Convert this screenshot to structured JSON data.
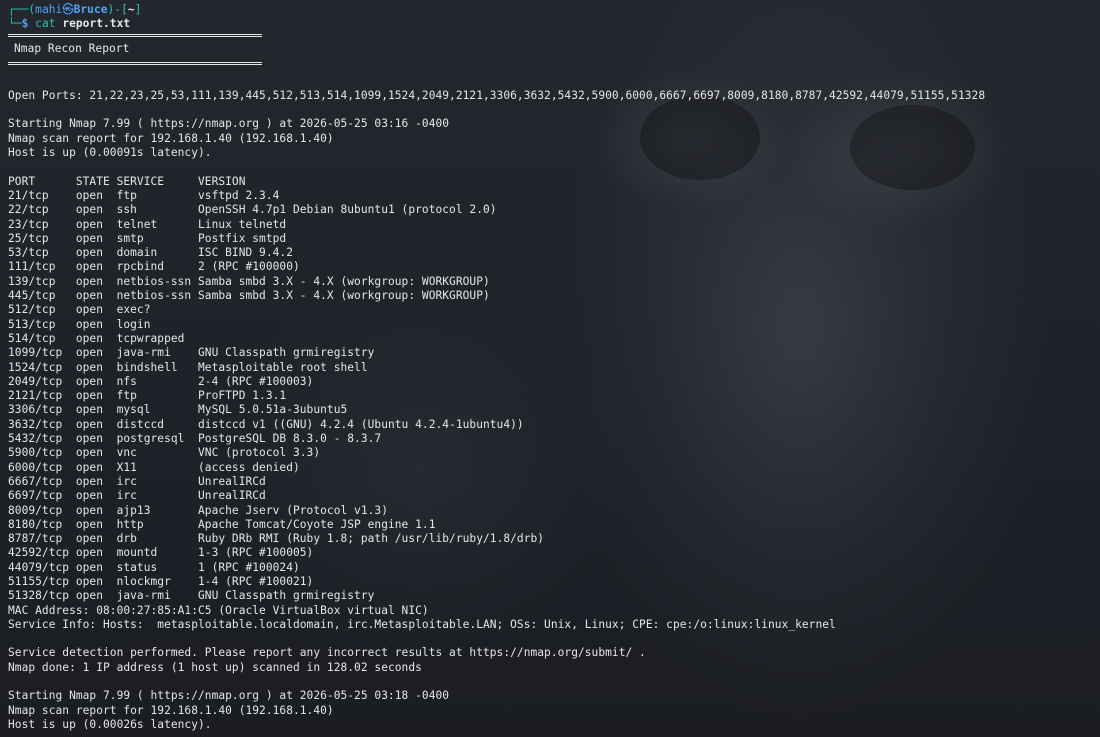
{
  "prompt": {
    "user": "mahi",
    "separator": "㉿",
    "host": "Bruce",
    "path": "~",
    "command": "cat",
    "argument": "report.txt"
  },
  "banner_title": "Nmap Recon Report",
  "open_ports_line": "Open Ports: 21,22,23,25,53,111,139,445,512,513,514,1099,1524,2049,2121,3306,3632,5432,5900,6000,6667,6697,8009,8180,8787,42592,44079,51155,51328",
  "scan1": {
    "starting": "Starting Nmap 7.99 ( https://nmap.org ) at 2026-05-25 03:16 -0400",
    "report_for": "Nmap scan report for 192.168.1.40 (192.168.1.40)",
    "host_up": "Host is up (0.00091s latency)."
  },
  "table": {
    "header": "PORT      STATE SERVICE     VERSION",
    "rows": [
      "21/tcp    open  ftp         vsftpd 2.3.4",
      "22/tcp    open  ssh         OpenSSH 4.7p1 Debian 8ubuntu1 (protocol 2.0)",
      "23/tcp    open  telnet      Linux telnetd",
      "25/tcp    open  smtp        Postfix smtpd",
      "53/tcp    open  domain      ISC BIND 9.4.2",
      "111/tcp   open  rpcbind     2 (RPC #100000)",
      "139/tcp   open  netbios-ssn Samba smbd 3.X - 4.X (workgroup: WORKGROUP)",
      "445/tcp   open  netbios-ssn Samba smbd 3.X - 4.X (workgroup: WORKGROUP)",
      "512/tcp   open  exec?",
      "513/tcp   open  login",
      "514/tcp   open  tcpwrapped",
      "1099/tcp  open  java-rmi    GNU Classpath grmiregistry",
      "1524/tcp  open  bindshell   Metasploitable root shell",
      "2049/tcp  open  nfs         2-4 (RPC #100003)",
      "2121/tcp  open  ftp         ProFTPD 1.3.1",
      "3306/tcp  open  mysql       MySQL 5.0.51a-3ubuntu5",
      "3632/tcp  open  distccd     distccd v1 ((GNU) 4.2.4 (Ubuntu 4.2.4-1ubuntu4))",
      "5432/tcp  open  postgresql  PostgreSQL DB 8.3.0 - 8.3.7",
      "5900/tcp  open  vnc         VNC (protocol 3.3)",
      "6000/tcp  open  X11         (access denied)",
      "6667/tcp  open  irc         UnrealIRCd",
      "6697/tcp  open  irc         UnrealIRCd",
      "8009/tcp  open  ajp13       Apache Jserv (Protocol v1.3)",
      "8180/tcp  open  http        Apache Tomcat/Coyote JSP engine 1.1",
      "8787/tcp  open  drb         Ruby DRb RMI (Ruby 1.8; path /usr/lib/ruby/1.8/drb)",
      "42592/tcp open  mountd      1-3 (RPC #100005)",
      "44079/tcp open  status      1 (RPC #100024)",
      "51155/tcp open  nlockmgr    1-4 (RPC #100021)",
      "51328/tcp open  java-rmi    GNU Classpath grmiregistry"
    ]
  },
  "mac_address": "MAC Address: 08:00:27:85:A1:C5 (Oracle VirtualBox virtual NIC)",
  "service_info": "Service Info: Hosts:  metasploitable.localdomain, irc.Metasploitable.LAN; OSs: Unix, Linux; CPE: cpe:/o:linux:linux_kernel",
  "service_detection": "Service detection performed. Please report any incorrect results at https://nmap.org/submit/ .",
  "nmap_done": "Nmap done: 1 IP address (1 host up) scanned in 128.02 seconds",
  "scan2": {
    "starting": "Starting Nmap 7.99 ( https://nmap.org ) at 2026-05-25 03:18 -0400",
    "report_for": "Nmap scan report for 192.168.1.40 (192.168.1.40)",
    "host_up": "Host is up (0.00026s latency)."
  },
  "colors": {
    "prompt_blue": "#4ea4f5",
    "prompt_teal": "#27c4b6",
    "text": "#e4e6ea",
    "background": "#1f2229"
  }
}
